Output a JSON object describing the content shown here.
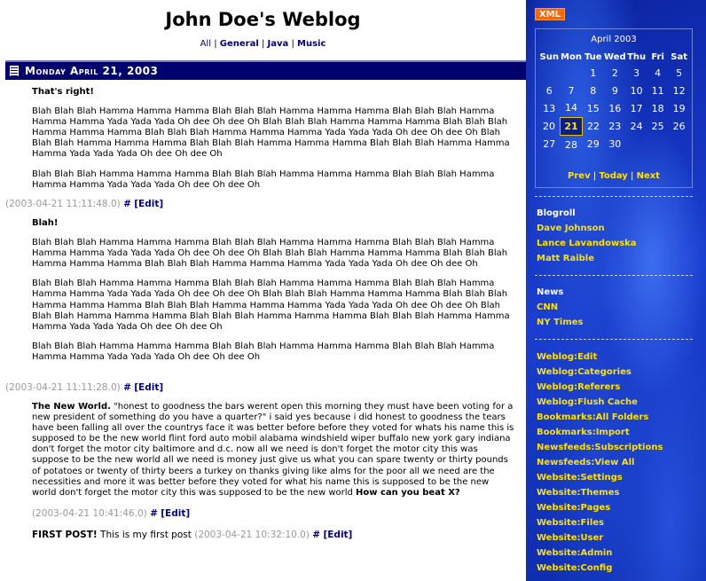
{
  "blog": {
    "title": "John Doe's Weblog"
  },
  "categories": {
    "all": "All",
    "general": "General",
    "java": "Java",
    "music": "Music",
    "sep": "|"
  },
  "day": {
    "label": "Monday April 21, 2003"
  },
  "entries": [
    {
      "title": "That's right!",
      "paragraphs": [
        "Blah Blah Blah Hamma Hamma Hamma Blah Blah Blah Hamma Hamma Hamma Blah Blah Blah Hamma Hamma Hamma Yada Yada Yada Oh dee Oh dee Oh Blah Blah Blah Hamma Hamma Hamma Blah Blah Blah Hamma Hamma Hamma Blah Blah Blah Hamma Hamma Hamma Yada Yada Yada Oh dee Oh dee Oh Blah Blah Blah Hamma Hamma Hamma Blah Blah Blah Hamma Hamma Hamma Blah Blah Blah Hamma Hamma Hamma Yada Yada Yada Oh dee Oh dee Oh",
        "Blah Blah Blah Hamma Hamma Hamma Blah Blah Blah Hamma Hamma Hamma Blah Blah Blah Hamma Hamma Hamma Yada Yada Yada Oh dee Oh dee Oh"
      ],
      "timestamp": "(2003-04-21 11:11:48.0)",
      "hash": "#",
      "edit": "[Edit]"
    },
    {
      "title": "Blah!",
      "paragraphs": [
        "Blah Blah Blah Hamma Hamma Hamma Blah Blah Blah Hamma Hamma Hamma Blah Blah Blah Hamma Hamma Hamma Yada Yada Yada Oh dee Oh dee Oh Blah Blah Blah Hamma Hamma Hamma Blah Blah Blah Hamma Hamma Hamma Blah Blah Blah Hamma Hamma Hamma Yada Yada Yada Oh dee Oh dee Oh",
        "Blah Blah Blah Hamma Hamma Hamma Blah Blah Blah Hamma Hamma Hamma Blah Blah Blah Hamma Hamma Hamma Yada Yada Yada Oh dee Oh dee Oh Blah Blah Blah Hamma Hamma Hamma Blah Blah Blah Hamma Hamma Hamma Blah Blah Blah Hamma Hamma Hamma Yada Yada Yada Oh dee Oh dee Oh Blah Blah Blah Hamma Hamma Hamma Blah Blah Blah Hamma Hamma Hamma Blah Blah Blah Hamma Hamma Hamma Yada Yada Yada Oh dee Oh dee Oh",
        "Blah Blah Blah Hamma Hamma Hamma Blah Blah Blah Hamma Hamma Hamma Blah Blah Blah Hamma Hamma Hamma Yada Yada Yada Oh dee Oh dee Oh"
      ],
      "timestamp": "(2003-04-21 11:11:28.0)",
      "hash": "#",
      "edit": "[Edit]"
    },
    {
      "title": "The New World.",
      "body": "\"honest to goodness the bars werent open this morning they must have been voting for a new president of something do you have a quarter?\" i said yes because i did honest to goodness the tears have been falling all over the countrys face it was better before before they voted for whats his name this is supposed to be the new world flint ford auto mobil alabama windshield wiper buffalo new york gary indiana don't forget the motor city baltimore and d.c. now all we need is don't forget the motor city this was suppose to be the new world all we need is money just give us what you can spare twenty or thirty pounds of potatoes or twenty of thirty beers a turkey on thanks giving like alms for the poor all we need are the necessities and more it was better before they voted for what his name this is supposed to be the new world don't forget the motor city this was supposed to be the new world",
      "closing": "How can you beat X?",
      "timestamp": "(2003-04-21 10:41:46.0)",
      "hash": "#",
      "edit": "[Edit]"
    },
    {
      "title": "FIRST POST!",
      "body": "This is my first post",
      "timestamp": "(2003-04-21 10:32:10.0)",
      "hash": "#",
      "edit": "[Edit]"
    }
  ],
  "sidebar": {
    "xml_badge": "XML",
    "calendar": {
      "month": "April 2003",
      "weekdays": [
        "Sun",
        "Mon",
        "Tue",
        "Wed",
        "Thu",
        "Fri",
        "Sat"
      ],
      "weeks": [
        [
          "",
          "",
          "1",
          "2",
          "3",
          "4",
          "5"
        ],
        [
          "6",
          "7",
          "8",
          "9",
          "10",
          "11",
          "12"
        ],
        [
          "13",
          "14",
          "15",
          "16",
          "17",
          "18",
          "19"
        ],
        [
          "20",
          "21",
          "22",
          "23",
          "24",
          "25",
          "26"
        ],
        [
          "27",
          "28",
          "29",
          "30",
          "",
          "",
          ""
        ]
      ],
      "today": "21",
      "nav": {
        "prev": "Prev",
        "today": "Today",
        "next": "Next",
        "sep": "|"
      }
    },
    "blogroll": {
      "title": "Blogroll",
      "links": [
        "Dave Johnson",
        "Lance Lavandowska",
        "Matt Raible"
      ]
    },
    "news": {
      "title": "News",
      "links": [
        "CNN",
        "NY Times"
      ]
    },
    "admin_links": [
      "Weblog:Edit",
      "Weblog:Categories",
      "Weblog:Referers",
      "Weblog:Flush Cache",
      "Bookmarks:All Folders",
      "Bookmarks:Import",
      "Newsfeeds:Subscriptions",
      "Newsfeeds:View All",
      "Website:Settings",
      "Website:Themes",
      "Website:Pages",
      "Website:Files",
      "Website:User",
      "Website:Admin",
      "Website:Config"
    ],
    "colors": {
      "background": "#0a2bb8",
      "link": "#ffe000",
      "xml_badge": "#ff6600"
    }
  }
}
